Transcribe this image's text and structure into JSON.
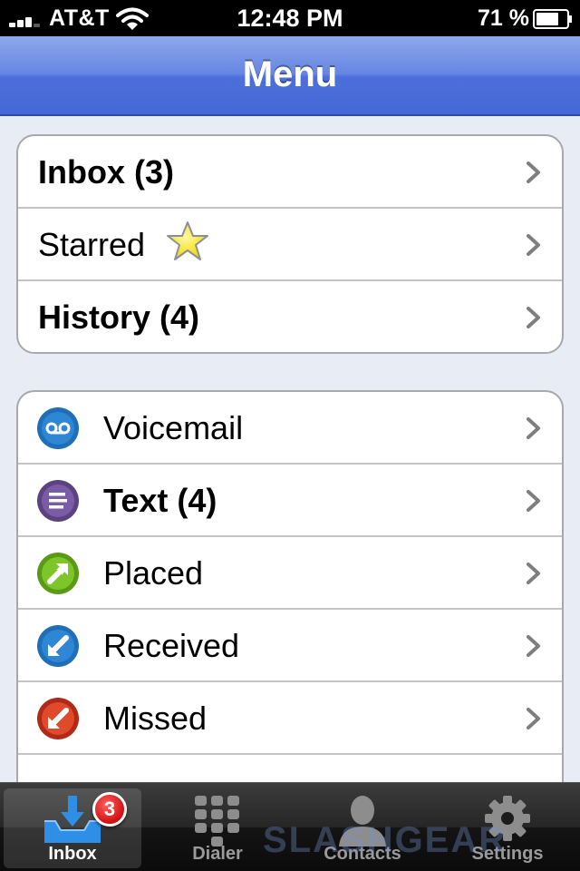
{
  "status_bar": {
    "carrier": "AT&T",
    "time": "12:48 PM",
    "battery": "71 %"
  },
  "nav": {
    "title": "Menu"
  },
  "group1": [
    {
      "label": "Inbox (3)",
      "bold": true
    },
    {
      "label": "Starred",
      "bold": false,
      "icon": "star-icon"
    },
    {
      "label": "History (4)",
      "bold": true
    }
  ],
  "group2": [
    {
      "label": "Voicemail",
      "bold": false,
      "icon": "voicemail-icon",
      "color": "#1f6fb8"
    },
    {
      "label": "Text (4)",
      "bold": true,
      "icon": "text-message-icon",
      "color": "#6a4f94"
    },
    {
      "label": "Placed",
      "bold": false,
      "icon": "placed-call-icon",
      "color": "#6cb41d"
    },
    {
      "label": "Received",
      "bold": false,
      "icon": "received-call-icon",
      "color": "#1f6fb8"
    },
    {
      "label": "Missed",
      "bold": false,
      "icon": "missed-call-icon",
      "color": "#d03a22"
    }
  ],
  "tab_bar": {
    "tabs": [
      {
        "label": "Inbox",
        "icon": "inbox-icon",
        "active": true,
        "badge": "3"
      },
      {
        "label": "Dialer",
        "icon": "keypad-icon",
        "active": false
      },
      {
        "label": "Contacts",
        "icon": "contact-icon",
        "active": false
      },
      {
        "label": "Settings",
        "icon": "gear-icon",
        "active": false
      }
    ]
  },
  "watermark": "SLASHGEAR",
  "colors": {
    "nav_blue": "#4c6fdb",
    "chevron": "#7f7f7f"
  }
}
